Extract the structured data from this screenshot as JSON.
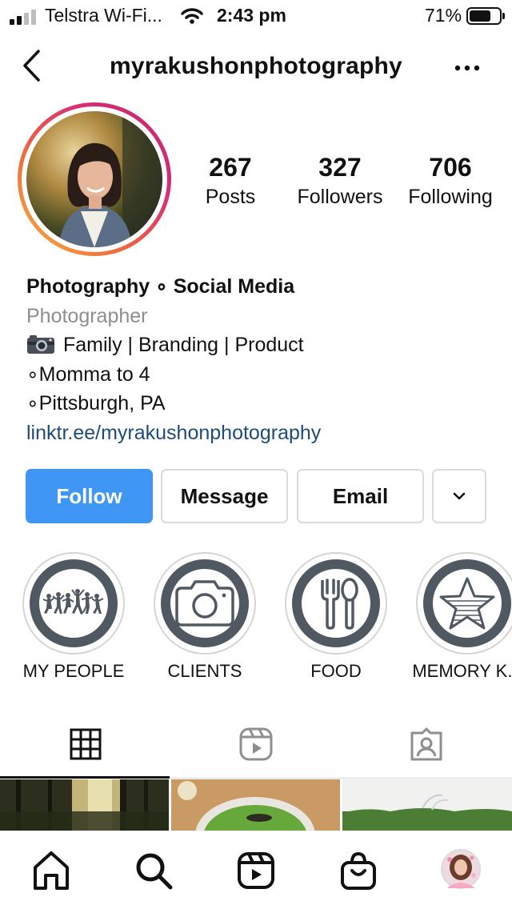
{
  "status_bar": {
    "carrier": "Telstra Wi-Fi...",
    "time": "2:43 pm",
    "battery_percent": "71%",
    "battery_level": 0.71,
    "signal_bars": 2
  },
  "header": {
    "username": "myrakushonphotography",
    "back_icon": "chevron-left-icon",
    "more_icon": "ellipsis-icon"
  },
  "stats": {
    "posts": {
      "value": "267",
      "label": "Posts"
    },
    "followers": {
      "value": "327",
      "label": "Followers"
    },
    "following": {
      "value": "706",
      "label": "Following"
    }
  },
  "bio": {
    "name": "Photography ∘ Social Media",
    "category": "Photographer",
    "line1": "Family | Branding | Product",
    "line2": "∘Momma to 4",
    "line3": "∘Pittsburgh, PA",
    "link": "linktr.ee/myrakushonphotography"
  },
  "buttons": {
    "follow": "Follow",
    "message": "Message",
    "email": "Email",
    "more_icon": "chevron-down-icon"
  },
  "highlights": [
    {
      "label": "MY PEOPLE",
      "icon": "dancing-people-icon"
    },
    {
      "label": "CLIENTS",
      "icon": "camera-icon"
    },
    {
      "label": "FOOD",
      "icon": "fork-spoon-icon"
    },
    {
      "label": "MEMORY K...",
      "icon": "star-icon"
    }
  ],
  "tabs": [
    {
      "name": "grid",
      "icon": "grid-icon",
      "active": true
    },
    {
      "name": "reels",
      "icon": "reels-icon",
      "active": false
    },
    {
      "name": "tagged",
      "icon": "tagged-user-icon",
      "active": false
    }
  ],
  "bottom_nav": [
    "home-icon",
    "search-icon",
    "reels-icon",
    "shop-icon",
    "profile-avatar"
  ],
  "colors": {
    "follow_blue": "#4096f5",
    "link_blue": "#1e4b7a",
    "highlight_ring": "#505862",
    "muted_text": "#8e8e8e"
  }
}
